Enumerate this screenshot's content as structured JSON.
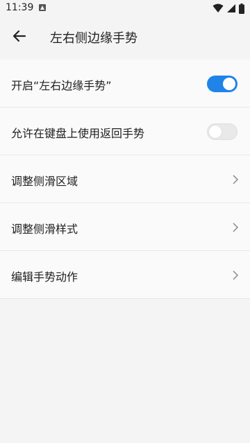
{
  "status_bar": {
    "time": "11:39",
    "icons": [
      "text-icon",
      "wifi-icon",
      "signal-icon",
      "battery-icon"
    ]
  },
  "header": {
    "title": "左右侧边缘手势",
    "back_icon": "back-arrow-icon"
  },
  "settings": [
    {
      "label": "开启“左右边缘手势”",
      "control": "toggle",
      "state": "on"
    },
    {
      "label": "允许在键盘上使用返回手势",
      "control": "toggle",
      "state": "off"
    },
    {
      "label": "调整侧滑区域",
      "control": "chevron"
    },
    {
      "label": "调整侧滑样式",
      "control": "chevron"
    },
    {
      "label": "编辑手势动作",
      "control": "chevron"
    }
  ],
  "colors": {
    "accent": "#1f83e8",
    "background": "#f4f4f4",
    "list_background": "#fafafa",
    "divider": "#e8e8e8"
  }
}
